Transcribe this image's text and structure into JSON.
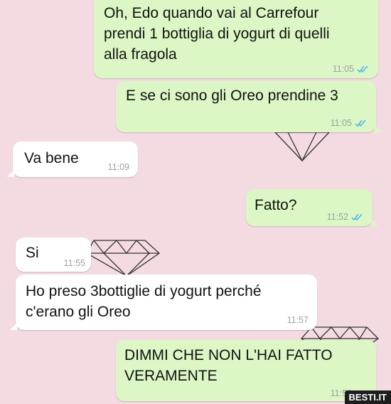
{
  "messages": [
    {
      "text": "Oh, Edo quando vai al Carrefour\nprendi 1 bottiglia di yogurt di quelli\nalla fragola",
      "time": "11:05"
    },
    {
      "text": "E se ci sono gli Oreo prendine 3",
      "time": "11:05"
    },
    {
      "text": "Va bene",
      "time": "11:09"
    },
    {
      "text": "Fatto?",
      "time": "11:52"
    },
    {
      "text": "Si",
      "time": "11:55"
    },
    {
      "text": "Ho preso 3bottiglie di yogurt perché\nc'erano gli Oreo",
      "time": "11:57"
    },
    {
      "text": "DIMMI CHE NON L'HAI FATTO\nVERAMENTE",
      "time": "11:58"
    }
  ],
  "watermark": "BESTI.IT",
  "colors": {
    "background": "#f4dbe2",
    "outgoing": "#dcf7c5",
    "incoming": "#ffffff",
    "read_ticks": "#4fb6ec",
    "time": "#9aa3a0"
  },
  "icons": [
    "double-check-icon",
    "diamond-doodle"
  ]
}
